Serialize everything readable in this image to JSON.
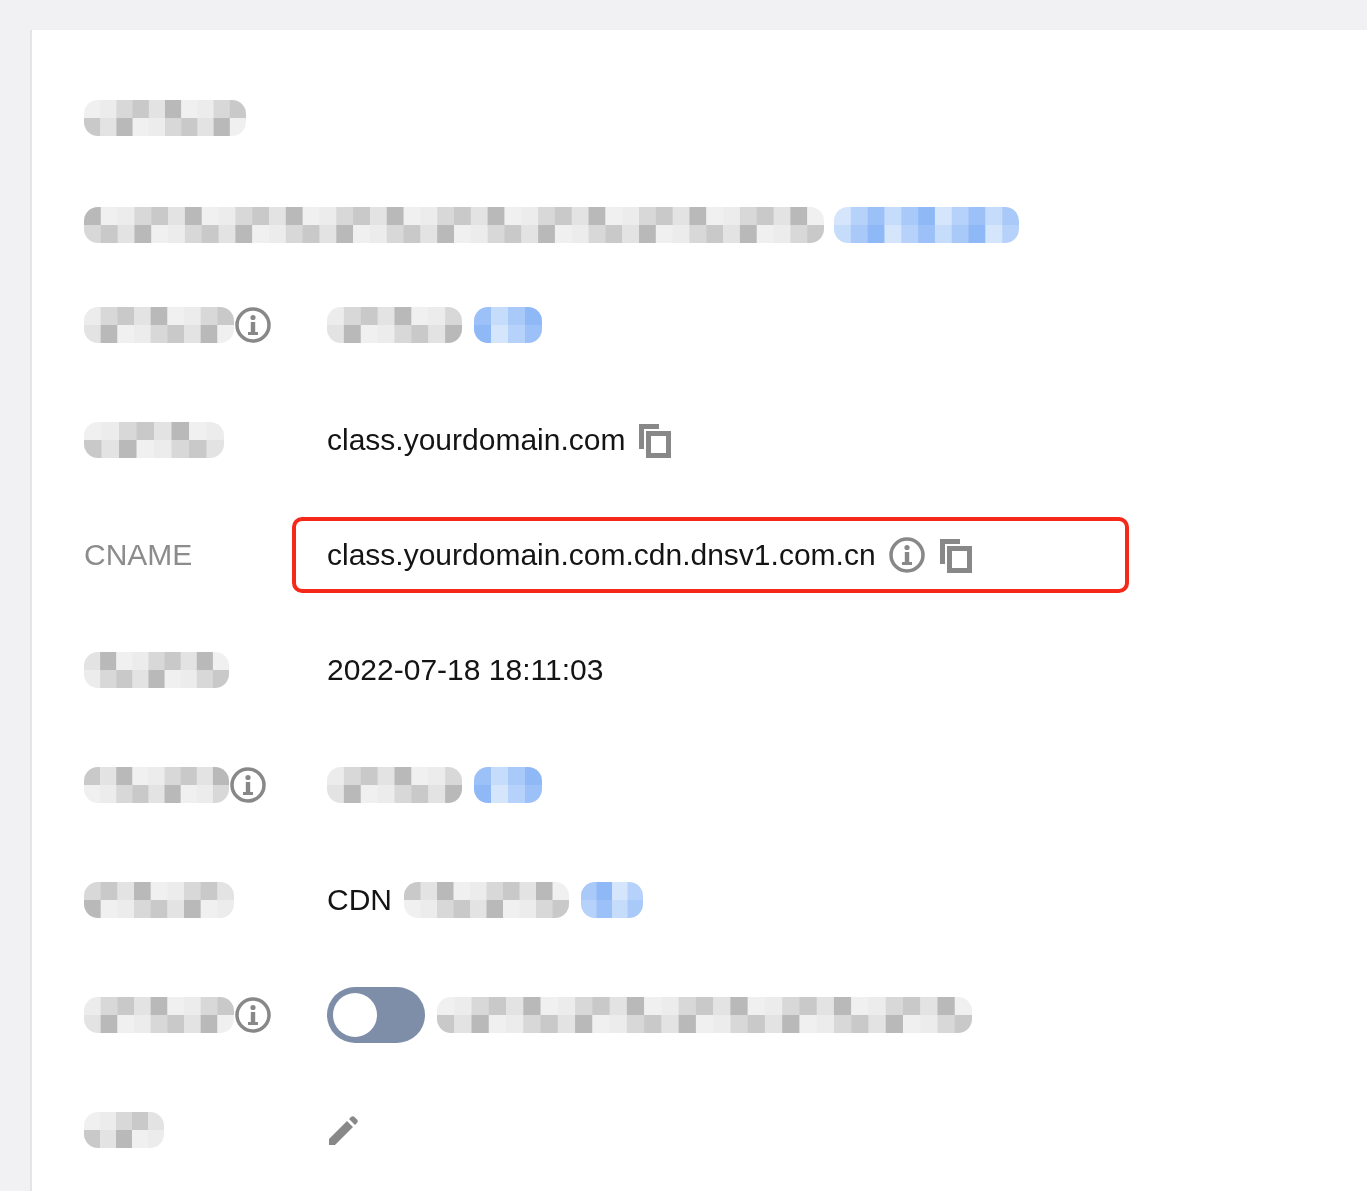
{
  "header": {
    "kind": "redacted"
  },
  "description": [
    {
      "kind": "redacted"
    },
    {
      "kind": "redacted-link"
    }
  ],
  "rows": [
    {
      "highlighted": false,
      "label": [
        {
          "kind": "redacted"
        },
        {
          "kind": "info-icon"
        }
      ],
      "value": [
        {
          "kind": "redacted"
        },
        {
          "kind": "redacted-link"
        }
      ]
    },
    {
      "highlighted": false,
      "label": [
        {
          "kind": "redacted"
        }
      ],
      "value": [
        {
          "kind": "text",
          "text": "class.yourdomain.com"
        },
        {
          "kind": "copy-icon"
        }
      ]
    },
    {
      "highlighted": true,
      "label": [
        {
          "kind": "text",
          "text": "CNAME"
        }
      ],
      "value": [
        {
          "kind": "text",
          "text": "class.yourdomain.com.cdn.dnsv1.com.cn"
        },
        {
          "kind": "info-icon"
        },
        {
          "kind": "copy-icon"
        }
      ]
    },
    {
      "highlighted": false,
      "label": [
        {
          "kind": "redacted"
        }
      ],
      "value": [
        {
          "kind": "text",
          "text": "2022-07-18 18:11:03"
        }
      ]
    },
    {
      "highlighted": false,
      "label": [
        {
          "kind": "redacted"
        },
        {
          "kind": "info-icon"
        }
      ],
      "value": [
        {
          "kind": "redacted"
        },
        {
          "kind": "redacted-link"
        }
      ]
    },
    {
      "highlighted": false,
      "label": [
        {
          "kind": "redacted"
        }
      ],
      "value": [
        {
          "kind": "text",
          "text": "CDN"
        },
        {
          "kind": "redacted"
        },
        {
          "kind": "redacted-link"
        }
      ]
    },
    {
      "highlighted": false,
      "label": [
        {
          "kind": "redacted"
        },
        {
          "kind": "info-icon"
        }
      ],
      "value": [
        {
          "kind": "toggle",
          "on": false
        },
        {
          "kind": "redacted"
        }
      ]
    },
    {
      "highlighted": false,
      "label": [
        {
          "kind": "redacted"
        }
      ],
      "value": [
        {
          "kind": "edit-icon"
        }
      ]
    }
  ]
}
